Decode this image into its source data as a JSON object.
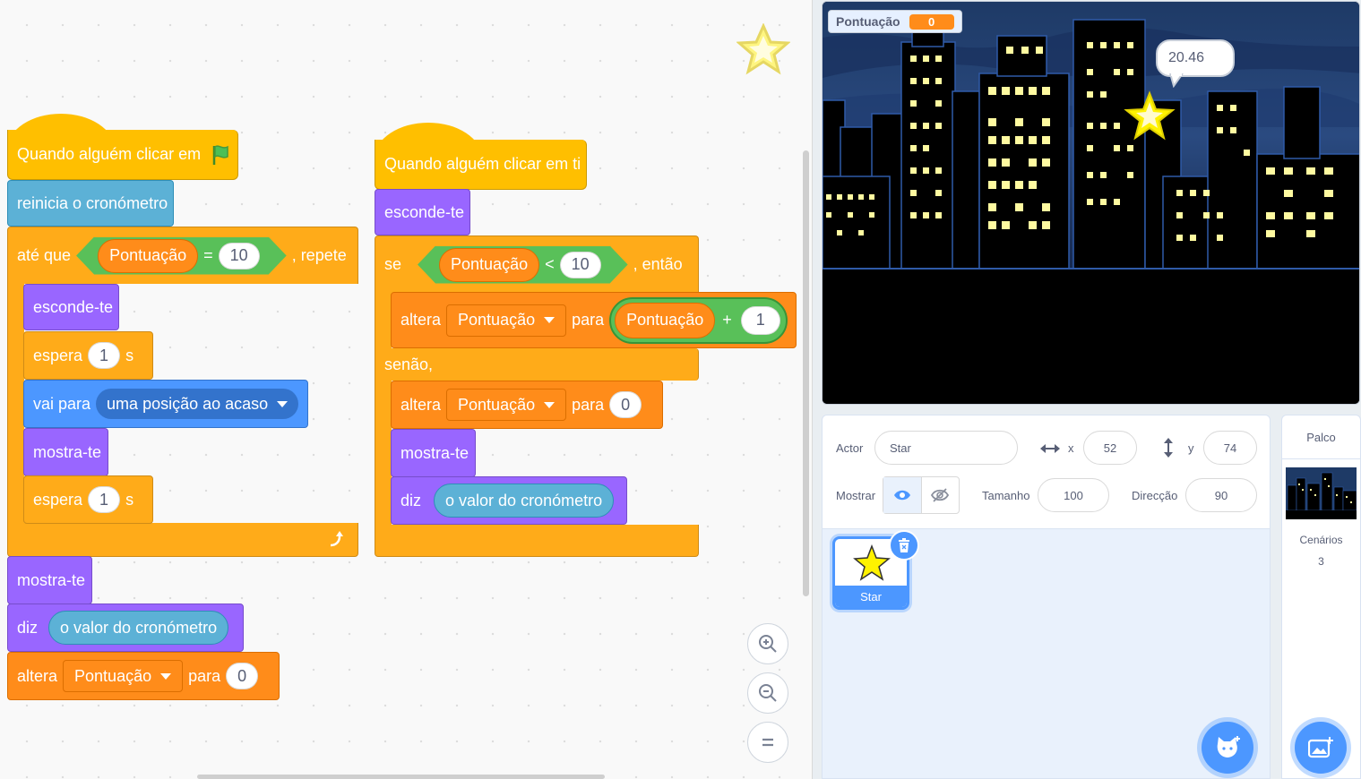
{
  "script1": {
    "hat": "Quando alguém clicar em",
    "reset_timer": "reinicia o cronómetro",
    "until_prefix": "até que",
    "until_var": "Pontuação",
    "until_op": "=",
    "until_value": "10",
    "until_suffix": ", repete",
    "hide": "esconde-te",
    "wait1_label": "espera",
    "wait1_value": "1",
    "wait1_unit": "s",
    "goto_label": "vai para",
    "goto_target": "uma posição ao acaso",
    "show": "mostra-te",
    "wait2_label": "espera",
    "wait2_value": "1",
    "wait2_unit": "s",
    "show2": "mostra-te",
    "say_label": "diz",
    "say_value": "o valor do cronómetro",
    "set_label": "altera",
    "set_var": "Pontuação",
    "set_to": "para",
    "set_value": "0"
  },
  "script2": {
    "hat": "Quando alguém clicar em ti",
    "hide": "esconde-te",
    "if_label": "se",
    "if_var": "Pontuação",
    "if_op": "<",
    "if_value": "10",
    "if_then": ", então",
    "set1_label": "altera",
    "set1_var": "Pontuação",
    "set1_to": "para",
    "set1_expr_var": "Pontuação",
    "set1_expr_op": "+",
    "set1_expr_value": "1",
    "else_label": "senão,",
    "set2_label": "altera",
    "set2_var": "Pontuação",
    "set2_to": "para",
    "set2_value": "0",
    "show": "mostra-te",
    "say_label": "diz",
    "say_value": "o valor do cronómetro"
  },
  "stage": {
    "monitor_label": "Pontuação",
    "monitor_value": "0",
    "bubble_text": "20.46"
  },
  "sprite_info": {
    "actor_label": "Actor",
    "actor_name": "Star",
    "x_label": "x",
    "x_value": "52",
    "y_label": "y",
    "y_value": "74",
    "show_label": "Mostrar",
    "size_label": "Tamanho",
    "size_value": "100",
    "direction_label": "Direcção",
    "direction_value": "90"
  },
  "sprites": [
    {
      "name": "Star",
      "selected": true
    }
  ],
  "stage_panel": {
    "title": "Palco",
    "backdrops_label": "Cenários",
    "backdrops_count": "3"
  },
  "colors": {
    "events": "#ffbf00",
    "control": "#ffab19",
    "looks": "#9966ff",
    "motion": "#4c97ff",
    "sensing": "#5cb1d6",
    "variables": "#ff8c1a",
    "operators": "#59c059"
  }
}
